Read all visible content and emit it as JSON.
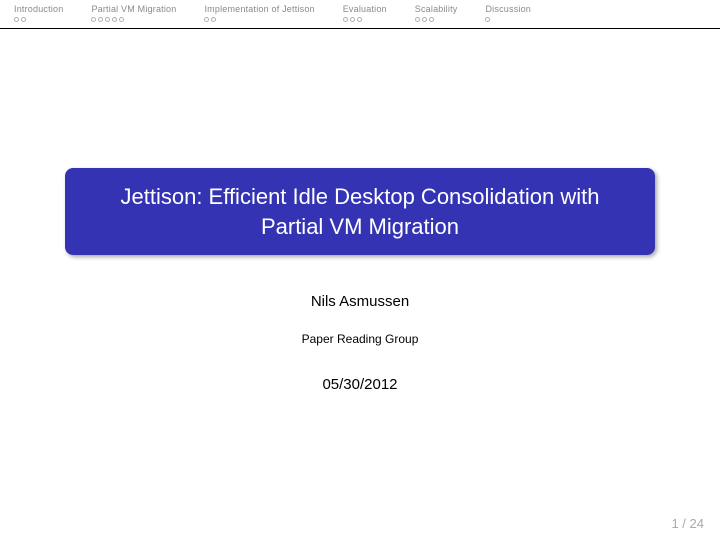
{
  "nav": {
    "sections": [
      {
        "label": "Introduction",
        "slides": 2
      },
      {
        "label": "Partial VM Migration",
        "slides": 5
      },
      {
        "label": "Implementation of Jettison",
        "slides": 2
      },
      {
        "label": "Evaluation",
        "slides": 3
      },
      {
        "label": "Scalability",
        "slides": 3
      },
      {
        "label": "Discussion",
        "slides": 1
      }
    ]
  },
  "title": "Jettison: Efficient Idle Desktop Consolidation with Partial VM Migration",
  "author": "Nils Asmussen",
  "group": "Paper Reading Group",
  "date": "05/30/2012",
  "page": {
    "current": "1",
    "sep": " / ",
    "total": "24"
  },
  "colors": {
    "accent": "#3333b3"
  }
}
